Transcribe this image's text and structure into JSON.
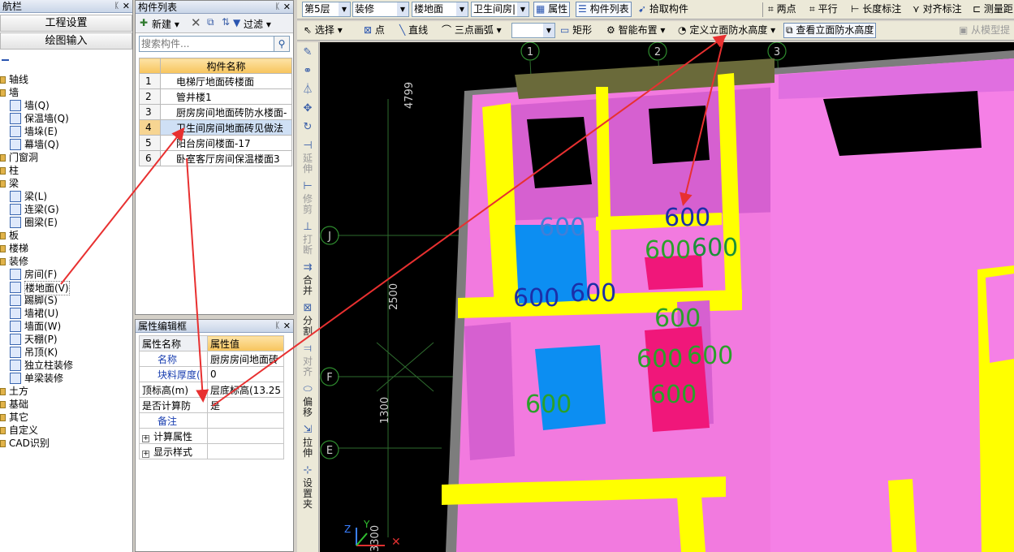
{
  "nav": {
    "title": "航栏",
    "buttons": [
      "工程设置",
      "绘图输入"
    ],
    "tree": [
      {
        "label": "轴线",
        "level": 1
      },
      {
        "label": "墙",
        "level": 1
      },
      {
        "label": "墙(Q)",
        "level": 2
      },
      {
        "label": "保温墙(Q)",
        "level": 2
      },
      {
        "label": "墙垛(E)",
        "level": 2
      },
      {
        "label": "幕墙(Q)",
        "level": 2
      },
      {
        "label": "门窗洞",
        "level": 1
      },
      {
        "label": "柱",
        "level": 1
      },
      {
        "label": "梁",
        "level": 1
      },
      {
        "label": "梁(L)",
        "level": 2
      },
      {
        "label": "连梁(G)",
        "level": 2
      },
      {
        "label": "圈梁(E)",
        "level": 2
      },
      {
        "label": "板",
        "level": 1
      },
      {
        "label": "楼梯",
        "level": 1
      },
      {
        "label": "装修",
        "level": 1
      },
      {
        "label": "房间(F)",
        "level": 2
      },
      {
        "label": "楼地面(V)",
        "level": 2,
        "selected": true
      },
      {
        "label": "踢脚(S)",
        "level": 2
      },
      {
        "label": "墙裙(U)",
        "level": 2
      },
      {
        "label": "墙面(W)",
        "level": 2
      },
      {
        "label": "天棚(P)",
        "level": 2
      },
      {
        "label": "吊顶(K)",
        "level": 2
      },
      {
        "label": "独立柱装修",
        "level": 2
      },
      {
        "label": "单梁装修",
        "level": 2
      },
      {
        "label": "土方",
        "level": 1
      },
      {
        "label": "基础",
        "level": 1
      },
      {
        "label": "其它",
        "level": 1
      },
      {
        "label": "自定义",
        "level": 1
      },
      {
        "label": "CAD识别",
        "level": 1
      }
    ]
  },
  "list": {
    "title": "构件列表",
    "new_label": "新建",
    "filter_label": "过滤",
    "search_placeholder": "搜索构件...",
    "header": "构件名称",
    "rows": [
      {
        "num": "1",
        "name": "电梯厅地面砖楼面"
      },
      {
        "num": "2",
        "name": "管井楼1"
      },
      {
        "num": "3",
        "name": "厨房房间地面砖防水楼面-"
      },
      {
        "num": "4",
        "name": "卫生间房间地面砖见做法",
        "highlight": true
      },
      {
        "num": "5",
        "name": "阳台房间楼面-17"
      },
      {
        "num": "6",
        "name": "卧室客厅房间保温楼面3"
      }
    ]
  },
  "props": {
    "title": "属性编辑框",
    "col_name": "属性名称",
    "col_value": "属性值",
    "rows": [
      {
        "k": "名称",
        "v": "厨房房间地面砖",
        "blue": true
      },
      {
        "k": "块料厚度(",
        "v": "0",
        "blue": true
      },
      {
        "k": "顶标高(m)",
        "v": "层底标高(13.25",
        "blue": false
      },
      {
        "k": "是否计算防",
        "v": "是",
        "blue": false
      },
      {
        "k": "备注",
        "v": "",
        "blue": true
      }
    ],
    "groups": [
      "计算属性",
      "显示样式"
    ]
  },
  "toolbar1": {
    "floor": "第5层",
    "category": "装修",
    "type": "楼地面",
    "item": "卫生间房|",
    "prop_btn": "属性",
    "list_btn": "构件列表",
    "pick_btn": "拾取构件",
    "two_point": "两点",
    "parallel": "平行",
    "length_dim": "长度标注",
    "align_dim": "对齐标注",
    "measure": "测量距"
  },
  "toolbar2": {
    "select": "选择",
    "point": "点",
    "line": "直线",
    "arc3": "三点画弧",
    "rect": "矩形",
    "smart": "智能布置",
    "define_wp": "定义立面防水高度",
    "view_wp": "查看立面防水高度",
    "from_model": "从模型提"
  },
  "side": [
    {
      "label": "",
      "icon": "✎"
    },
    {
      "label": "",
      "icon": "⚭"
    },
    {
      "label": "",
      "icon": "⏃"
    },
    {
      "label": "",
      "icon": "✥"
    },
    {
      "label": "",
      "icon": "↻"
    },
    {
      "label": "延伸",
      "icon": "⊣",
      "dis": true
    },
    {
      "label": "修剪",
      "icon": "⊢",
      "dis": true
    },
    {
      "label": "打断",
      "icon": "⊥",
      "dis": true
    },
    {
      "label": "合并",
      "icon": "⇉"
    },
    {
      "label": "分割",
      "icon": "⊠"
    },
    {
      "label": "对齐",
      "icon": "⫤",
      "dis": true
    },
    {
      "label": "偏移",
      "icon": "⬭"
    },
    {
      "label": "拉伸",
      "icon": "⇲"
    },
    {
      "label": "设置夹",
      "icon": "⊹"
    }
  ],
  "canvas": {
    "axes": [
      {
        "label": "1"
      },
      {
        "label": "2"
      },
      {
        "label": "3"
      },
      {
        "label": "J"
      },
      {
        "label": "F"
      },
      {
        "label": "E"
      }
    ],
    "dims": [
      "4799",
      "2500",
      "1300",
      "3300"
    ],
    "wp_label": "600",
    "triad": [
      "Z",
      "Y"
    ]
  }
}
